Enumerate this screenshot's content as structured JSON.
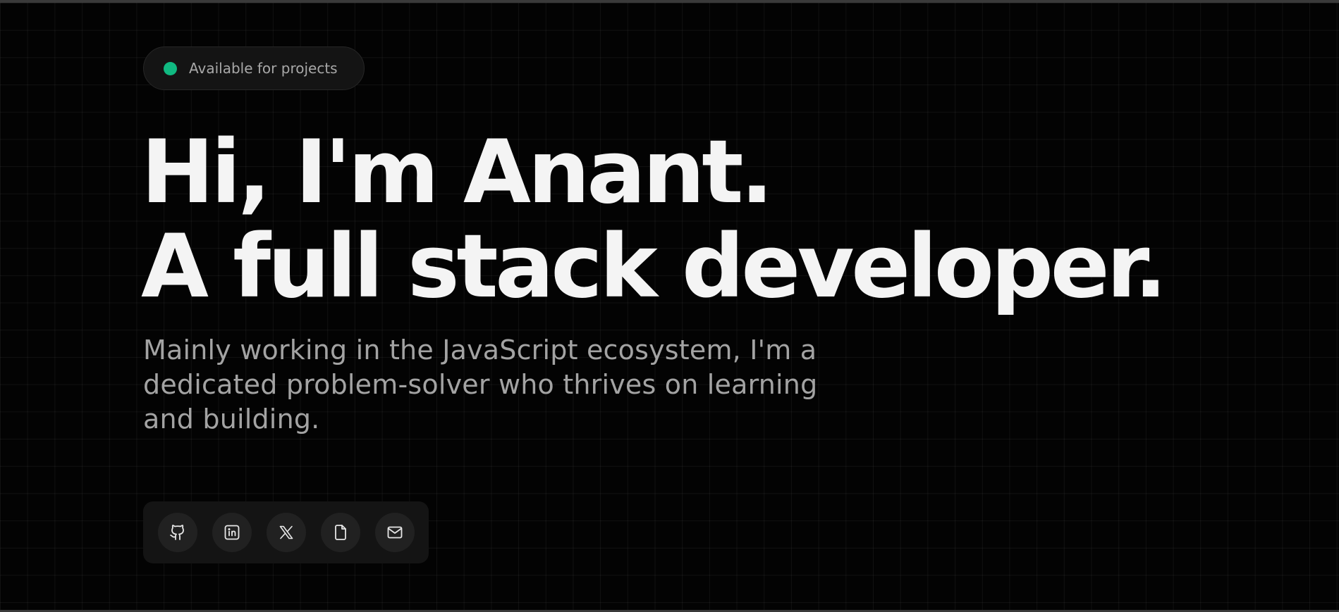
{
  "status": {
    "label": "Available for projects",
    "dot_color": "#10b981"
  },
  "hero": {
    "headline_line1": "Hi, I'm Anant.",
    "headline_line2": "A full stack developer.",
    "intro": "Mainly working in the JavaScript ecosystem, I'm a dedicated problem-solver who thrives on learning and building."
  },
  "social_links": [
    {
      "icon": "github-icon"
    },
    {
      "icon": "linkedin-icon"
    },
    {
      "icon": "x-icon"
    },
    {
      "icon": "resume-document-icon"
    },
    {
      "icon": "mail-icon"
    }
  ],
  "colors": {
    "background": "#030303",
    "headline": "#f4f4f4",
    "body_text": "#a3a3a3",
    "accent": "#10b981"
  }
}
